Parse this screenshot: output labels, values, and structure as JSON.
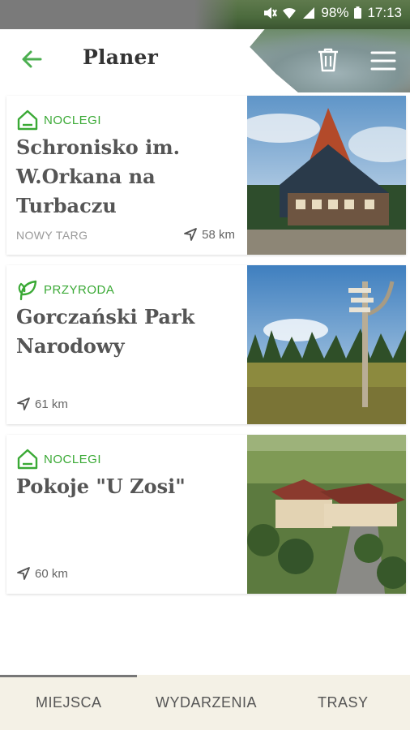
{
  "status": {
    "battery": "98%",
    "time": "17:13"
  },
  "header": {
    "title": "Planer"
  },
  "places": [
    {
      "category": "NOCLEGI",
      "category_icon": "house-icon",
      "name": "Schronisko im. W.Orkana na Turbaczu",
      "city": "NOWY TARG",
      "distance": "58 km"
    },
    {
      "category": "PRZYRODA",
      "category_icon": "leaf-icon",
      "name": "Gorczański Park Narodowy",
      "city": "",
      "distance": "61 km"
    },
    {
      "category": "NOCLEGI",
      "category_icon": "house-icon",
      "name": "Pokoje \"U Zosi\"",
      "city": "",
      "distance": "60 km"
    }
  ],
  "tabs": [
    {
      "label": "MIEJSCA"
    },
    {
      "label": "WYDARZENIA"
    },
    {
      "label": "TRASY"
    }
  ],
  "colors": {
    "accent": "#3aa935",
    "tab_bg": "#f4f1e6"
  }
}
